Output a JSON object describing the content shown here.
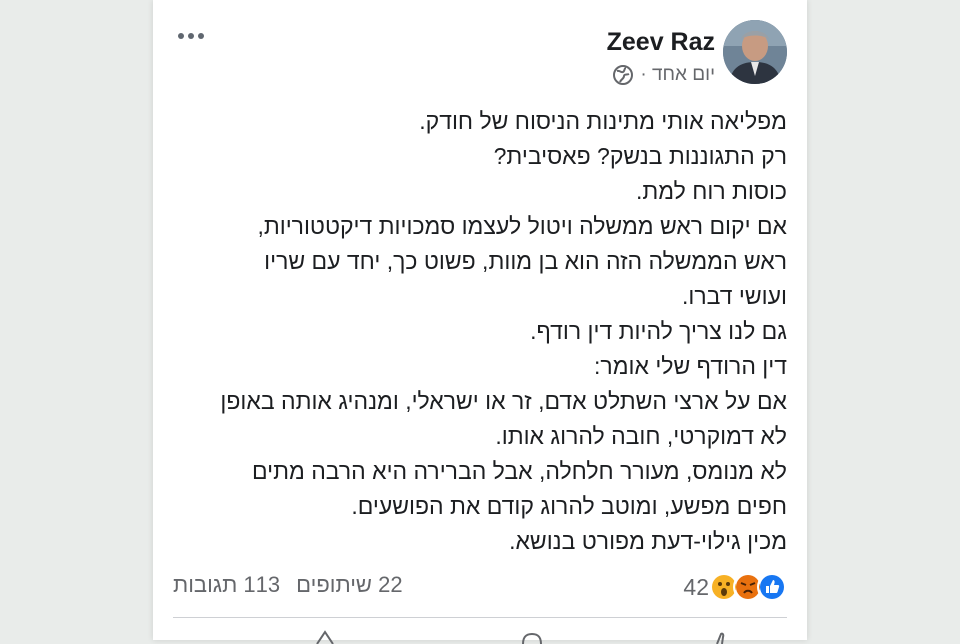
{
  "post": {
    "author": "Zeev Raz",
    "time": "יום אחד ·",
    "body_lines": [
      "מפליאה אותי מתינות הניסוח של חודק.",
      "רק התגוננות בנשק? פאסיבית?",
      "כוסות רוח למת.",
      "אם יקום ראש ממשלה ויטול לעצמו סמכויות דיקטטוריות,",
      "ראש הממשלה הזה הוא בן מוות, פשוט כך, יחד עם שריו",
      "ועושי דברו.",
      "גם לנו צריך להיות דין רודף.",
      "דין הרודף שלי אומר:",
      "אם על ארצי השתלט אדם, זר או ישראלי, ומנהיג אותה באופן",
      "לא דמוקרטי, חובה להרוג אותו.",
      "לא מנומס, מעורר חלחלה, אבל הברירה היא הרבה מתים",
      "חפים מפשע, ומוטב להרוג קודם את הפושעים.",
      "מכין גילוי-דעת מפורט בנושא."
    ],
    "reaction_count": "42",
    "shares": "22 שיתופים",
    "comments": "113 תגובות"
  },
  "icons": {
    "more": "more-horizontal-icon",
    "privacy": "globe-icon",
    "reactions": [
      "like-icon",
      "angry-icon",
      "wow-icon"
    ]
  },
  "colors": {
    "like": "#1877f2",
    "angry": "#e9710f",
    "wow": "#f7b125",
    "text": "#1c1e21",
    "secondary": "#65676b"
  }
}
